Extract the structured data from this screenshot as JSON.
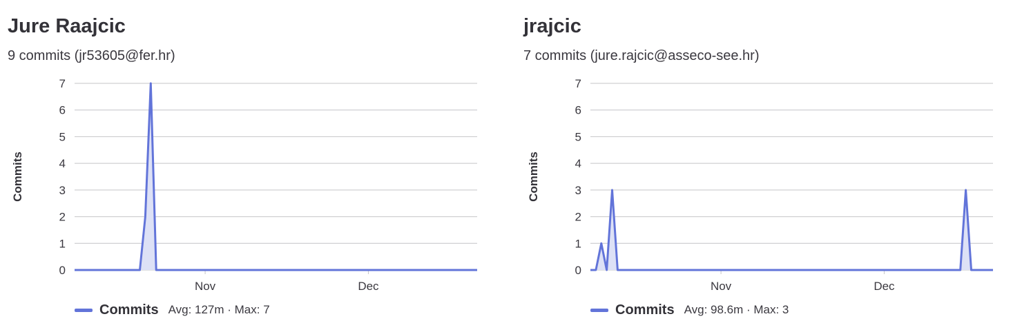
{
  "colors": {
    "series": "#6274d9",
    "area": "#dde1f6",
    "grid": "#c4c4c7",
    "text": "#333238"
  },
  "authors": [
    {
      "name": "Jure Raajcic",
      "subtitle": "9 commits (jr53605@fer.hr)",
      "legend": {
        "label": "Commits",
        "stats": "Avg: 127m · Max: 7"
      }
    },
    {
      "name": "jrajcic",
      "subtitle": "7 commits (jure.rajcic@asseco-see.hr)",
      "legend": {
        "label": "Commits",
        "stats": "Avg: 98.6m · Max: 3"
      }
    }
  ],
  "chart_data": [
    {
      "type": "area",
      "ylabel": "Commits",
      "ylim": [
        0,
        7
      ],
      "yticks": [
        "0",
        "1",
        "2",
        "3",
        "4",
        "5",
        "6",
        "7"
      ],
      "xticks": [
        "Nov",
        "Dec"
      ],
      "grid": true,
      "legend_position": "bottom-left",
      "x": [
        "2020-10-09",
        "2020-10-10",
        "2020-10-11",
        "2020-10-12",
        "2020-10-13",
        "2020-10-14",
        "2020-10-15",
        "2020-10-16",
        "2020-10-17",
        "2020-10-18",
        "2020-10-19",
        "2020-10-20",
        "2020-10-21",
        "2020-10-22",
        "2020-10-23",
        "2020-10-24",
        "2020-10-25",
        "2020-10-26",
        "2020-12-20"
      ],
      "series": [
        {
          "name": "Commits",
          "values": [
            0,
            0,
            0,
            0,
            0,
            0,
            0,
            0,
            0,
            0,
            0,
            0,
            2,
            7,
            0,
            0,
            0,
            0,
            0
          ]
        }
      ]
    },
    {
      "type": "area",
      "ylabel": "Commits",
      "ylim": [
        0,
        7
      ],
      "yticks": [
        "0",
        "1",
        "2",
        "3",
        "4",
        "5",
        "6",
        "7"
      ],
      "xticks": [
        "Nov",
        "Dec"
      ],
      "grid": true,
      "legend_position": "bottom-left",
      "x": [
        "2020-10-09",
        "2020-10-10",
        "2020-10-11",
        "2020-10-12",
        "2020-10-13",
        "2020-12-14",
        "2020-12-15",
        "2020-12-16",
        "2020-12-17",
        "2020-12-18"
      ],
      "series": [
        {
          "name": "Commits",
          "values": [
            0,
            1,
            0,
            3,
            0,
            0,
            0,
            3,
            0,
            0
          ]
        }
      ]
    }
  ]
}
